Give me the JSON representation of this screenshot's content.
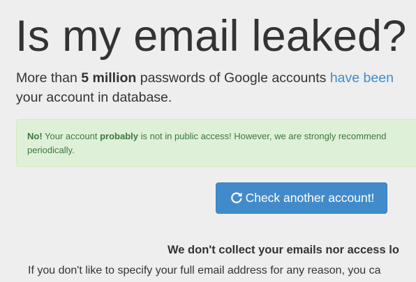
{
  "header": {
    "title": "Is my email leaked?"
  },
  "lead": {
    "text_before": "More than ",
    "emphasis": "5 million",
    "text_after": " passwords of Google accounts ",
    "link_text": "have been",
    "line2": "your account in database."
  },
  "alert": {
    "no_label": "No!",
    "text1": " Your account ",
    "probably": "probably",
    "text2": " is not in public access! However, we are strongly recommend",
    "line2": "periodically."
  },
  "actions": {
    "check_another_label": "Check another account!",
    "check_another_icon": "refresh-icon"
  },
  "privacy": {
    "heading": "We don't collect your emails nor access lo",
    "text": "If you don't like to specify your full email address for any reason, you ca"
  },
  "colors": {
    "link": "#428bca",
    "button_bg": "#428bca",
    "alert_bg": "#dff0d8",
    "alert_text": "#3c763d",
    "page_bg": "#eeeeee"
  }
}
